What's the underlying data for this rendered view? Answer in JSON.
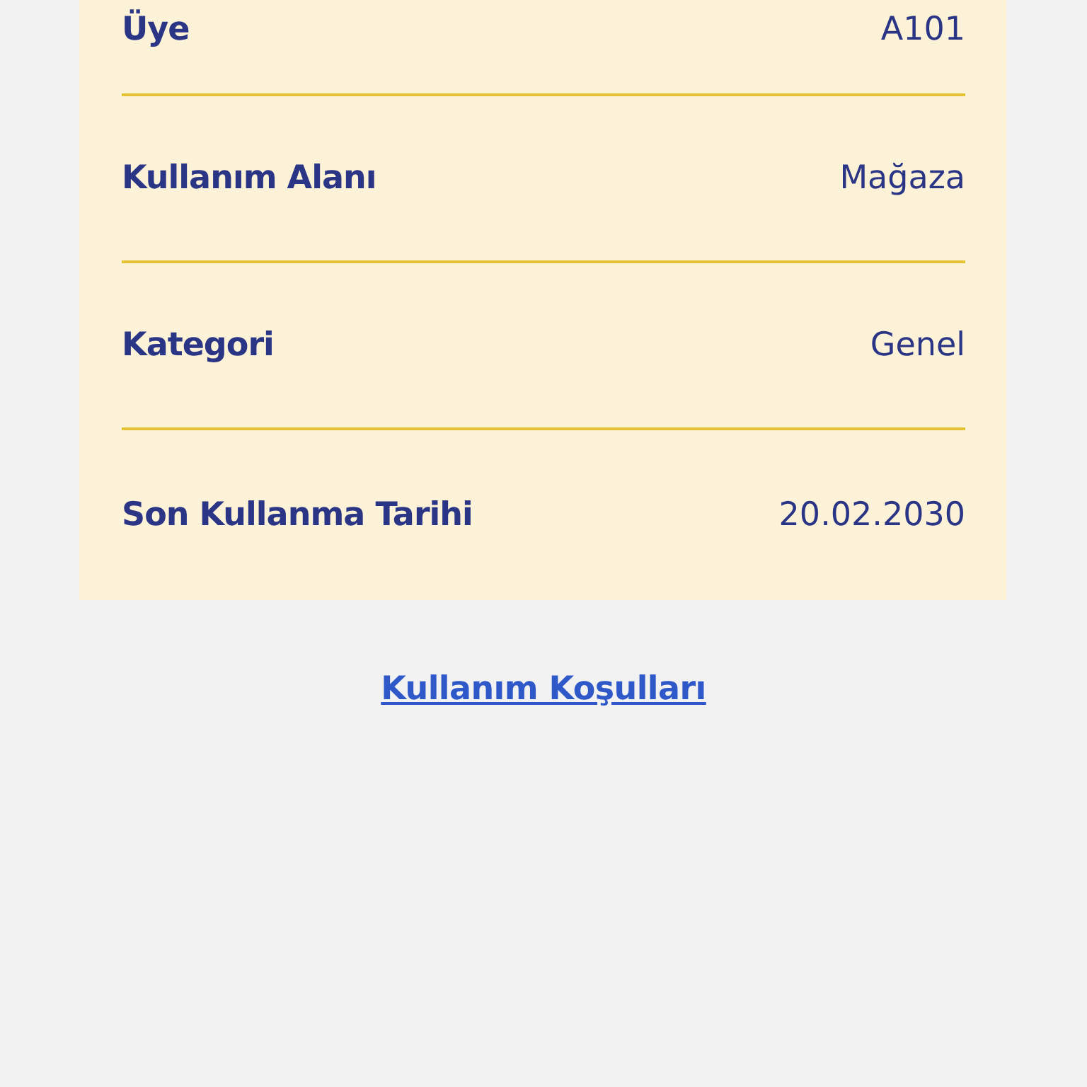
{
  "details": [
    {
      "label": "Üye",
      "value": "A101"
    },
    {
      "label": "Kullanım Alanı",
      "value": "Mağaza"
    },
    {
      "label": "Kategori",
      "value": "Genel"
    },
    {
      "label": "Son Kullanma Tarihi",
      "value": "20.02.2030"
    }
  ],
  "terms_link": "Kullanım Koşulları"
}
